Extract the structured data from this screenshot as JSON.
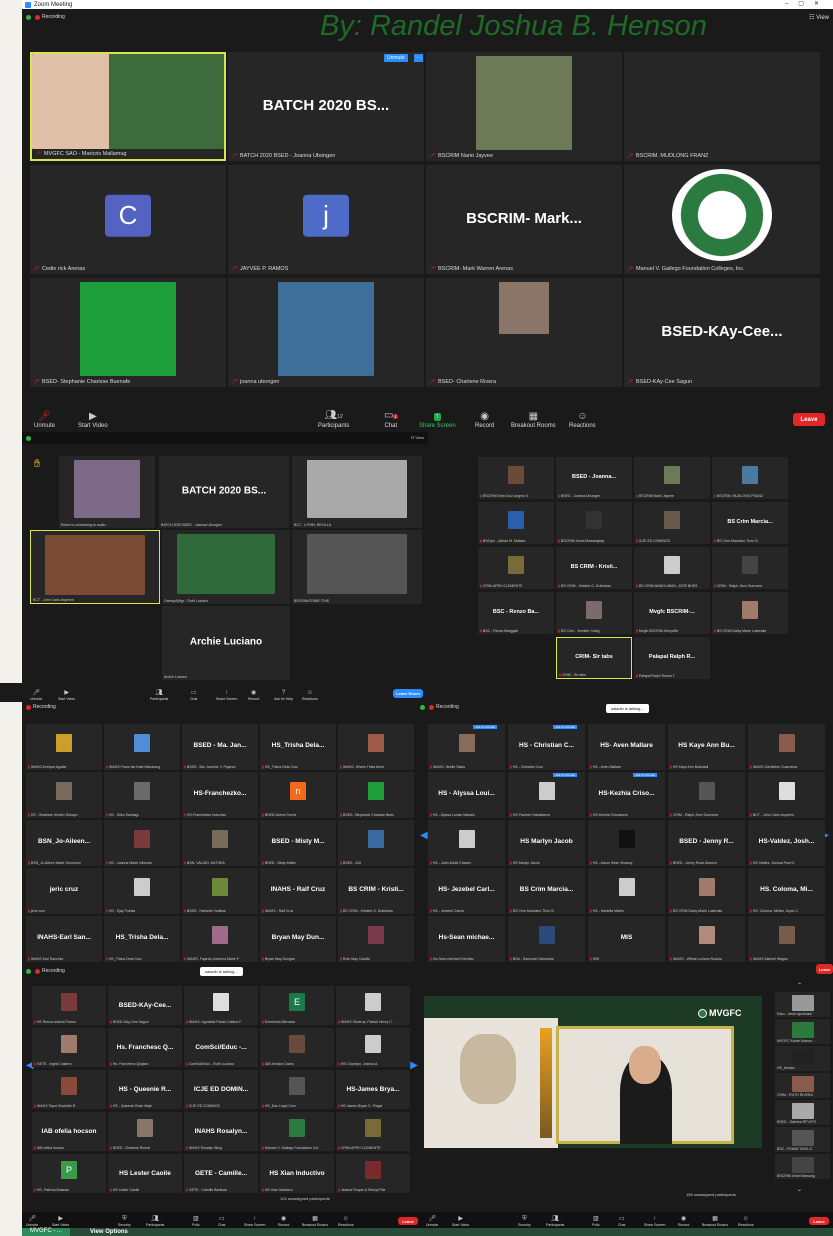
{
  "app_title": "Zoom Meeting",
  "recording": "Recording",
  "gallery_view": "View",
  "watermark": "By: Randel Joshua B. Henson",
  "unmute_small": "Unmute",
  "main_tiles": [
    {
      "name": "MVGFC SAO - Maricris Mallamug",
      "big": "",
      "photo": "#3d6b3b"
    },
    {
      "name": "BATCH 2020 BSED - Joanna Ubongen",
      "big": "BATCH 2020 BS..."
    },
    {
      "name": "BSCRIM Nario Jayvee",
      "big": "",
      "photo": "#6d7a58"
    },
    {
      "name": "BSCRIM. MUDLONG FRANZ",
      "big": ""
    },
    {
      "name": "Cedie rick Arenas",
      "big": "",
      "avatar": "C",
      "avatar_color": "#5462c2"
    },
    {
      "name": "JAYVEE P. RAMOS",
      "big": "",
      "avatar": "j",
      "avatar_color": "#4e6bc7"
    },
    {
      "name": "BSCRIM- Mark Warren Arenas",
      "big": "BSCRIM-  Mark..."
    },
    {
      "name": "Manuel V. Gallego Foundation Colleges, Inc.",
      "big": "",
      "photo": "#2b7a3f"
    },
    {
      "name": "BSED- Stephanie Charisse Buenafe",
      "big": "",
      "photo": "#1f9e3c"
    },
    {
      "name": "joanna ubongen",
      "big": "",
      "photo": "#3d6f99"
    },
    {
      "name": "BSED- Charlene Rivera",
      "big": "",
      "photo": "#8a7569"
    },
    {
      "name": "BSED-KAy-Cee Sagun",
      "big": "BSED-KAy-Cee..."
    }
  ],
  "toolbar": {
    "unmute": "Unmute",
    "start_video": "Start Video",
    "participants": "Participants",
    "participants_count": "12",
    "chat": "Chat",
    "chat_badge": "1",
    "share_screen": "Share Screen",
    "record": "Record",
    "breakout": "Breakout Rooms",
    "reactions": "Reactions",
    "leave": "Leave"
  },
  "win2": {
    "tiles": [
      {
        "name": "Eldice is connecting to audio...",
        "big": "",
        "photo": "#7c6a86"
      },
      {
        "name": "BATCH 2020 BSED - Joanna Ubongen",
        "big": "BATCH 2020 BS..."
      },
      {
        "name": "BCT - LYRIEL REVILLA",
        "big": "",
        "photo": "#a9a9a9"
      },
      {
        "name": "BCT - John Carlo Asperen",
        "big": "",
        "photo": "#7a4a34"
      },
      {
        "name": "Cams(uf)Mgr - Ruth Luciano",
        "big": "",
        "photo": "#2f6b3a"
      },
      {
        "name": "BSCRIM/CRIME-THIS",
        "big": "",
        "photo": "#555"
      },
      {
        "name": "Archie Luciano",
        "big": "Archie Luciano"
      }
    ],
    "toolbar": {
      "participants": "Participants",
      "participants_count": "7",
      "chat": "Chat",
      "share": "Share Screen",
      "record": "Record",
      "help": "Ask for Help",
      "reactions": "Reactions",
      "leave": "Leave Room"
    }
  },
  "win3": {
    "tiles": [
      {
        "label": "",
        "name": "BSCRIM Dela Cruz Angelo K.",
        "p": "#6b4a3a"
      },
      {
        "label": "BSED - Joanna...",
        "name": "BSED - Joanna Ubongen"
      },
      {
        "label": "",
        "name": "BSCRIM Nario Jayvee",
        "p": "#6d7a58"
      },
      {
        "label": "",
        "name": "BSCRIM. MUDLONG FRANZ",
        "p": "#4a7aa0"
      },
      {
        "label": "",
        "name": "BSCrpn - Adrian M. Mallare",
        "p": "#2a5fb0"
      },
      {
        "label": "",
        "name": "BSCRIM Jewel Mawangbay",
        "p": "#333"
      },
      {
        "label": "",
        "name": "ICJE ED DOMINGO",
        "p": "#6a5a4a"
      },
      {
        "label": "BS Crim Marcia...",
        "name": "BS Crim Marciano Tinio III"
      },
      {
        "label": "",
        "name": "CRIM-APEH CLEMENTE",
        "p": "#7a6a3a"
      },
      {
        "label": "BS CRIM - Kristi...",
        "name": "BS CRIM - Kristine G. Dublubas"
      },
      {
        "label": "",
        "name": "BS CRIM MANGLIWAN, JOSE BHES",
        "p": "#ccc"
      },
      {
        "label": "",
        "name": "CRIM - Ralph Jhon Guevarra",
        "p": "#444"
      },
      {
        "label": "BSC - Renzo Ba...",
        "name": "BSC - Renzo Banggali"
      },
      {
        "label": "",
        "name": "BS Crim - Jennifer Cabig",
        "p": "#7a6c6a"
      },
      {
        "label": "Mvgfc  BSCRIM-...",
        "name": "Mvgfc BSCRIM-Kenyaffic"
      },
      {
        "label": "",
        "name": "BS CRIM Daisy Marie Lusenata",
        "p": "#a07a6a"
      },
      {
        "label": "CRIM- Sir tabs",
        "name": "CRIM - Sir tabs"
      },
      {
        "label": "Palapal  Ralph R...",
        "name": "Palapal Ralph Raven T"
      }
    ]
  },
  "win4": {
    "talking": "saladin is talking...",
    "tiles": [
      {
        "label": "",
        "name": "INAHS-Enrique Aguilar",
        "p": "#c9a02a"
      },
      {
        "label": "",
        "name": "INAHS Franz Ian Kate Manarang",
        "p": "#4f8ed6"
      },
      {
        "label": "BSED - Ma. Jan...",
        "name": "BSED - Ma. Jannine V. Pajaron"
      },
      {
        "label": "HS_Trisha  Dela...",
        "name": "HS_Trisha Dela Cruz"
      },
      {
        "label": "",
        "name": "INAHS- Hilarrs Trisia Anne",
        "p": "#a05a4a"
      },
      {
        "label": "",
        "name": "HS - Sharlane Kirsten Dimayu",
        "p": "#7a6a5a"
      },
      {
        "label": "",
        "name": "HS - Stiko Santiago",
        "p": "#6a6a6a"
      },
      {
        "label": "HS-Franchezko...",
        "name": "HS-Franchezko Inductivo"
      },
      {
        "label": "",
        "name": "BSED-Noemi Torres",
        "avatar": "n",
        "ac": "#f26a1a"
      },
      {
        "label": "",
        "name": "BSED- Stephanie Charisse Buen",
        "p": "#1f9e3c"
      },
      {
        "label": "BSN_Jo-Aileen...",
        "name": "BSN_Jo-Aileen Marie Geronimo"
      },
      {
        "label": "",
        "name": "HS - Joanna Marie Ulbunan",
        "p": "#7a3a3a"
      },
      {
        "label": "",
        "name": "BSN- VALINO, ANTHEA",
        "p": "#7a6a5a"
      },
      {
        "label": "BSED - Misty M...",
        "name": "BSED - Misty Mateo"
      },
      {
        "label": "",
        "name": "BSED - IDA",
        "p": "#3a6aa0"
      },
      {
        "label": "jeric cruz",
        "name": "jeric cruz"
      },
      {
        "label": "",
        "name": "HS - Ejay Fuelda",
        "p": "#ccc"
      },
      {
        "label": "",
        "name": "BSED - Harlaine Vodillas",
        "p": "#6a8a3a"
      },
      {
        "label": "INAHS - Ralf Cruz",
        "name": "INAHS - Ralf Cruz"
      },
      {
        "label": "BS CRIM - Kristi...",
        "name": "BS CRIM - Kristine G. Dublubas"
      },
      {
        "label": "INAHS-Earl San...",
        "name": "INAHS Earl Sanchez"
      },
      {
        "label": "HS_Trisha  Dela...",
        "name": "HS_Trisha Dela Cruz"
      },
      {
        "label": "",
        "name": "INAHS- Fajardo,Joahnna Marie F.",
        "p": "#a06a8a"
      },
      {
        "label": "Bryan May Dun...",
        "name": "Bryan May Dungao"
      },
      {
        "label": "",
        "name": "Ruth May Castillo",
        "p": "#7a3a4a"
      }
    ]
  },
  "win5": {
    "talking": "saladin is talking...",
    "tiles": [
      {
        "label": "",
        "name": "INAHS- Ibrelle Salas",
        "p": "#8a6a5a",
        "btn": "Ask to Unmute"
      },
      {
        "label": "HS - Christian C...",
        "name": "HS - Christian Cruz",
        "btn": "Ask to Unmute"
      },
      {
        "label": "HS- Aven Mallare",
        "name": "HS - Aven Mallare"
      },
      {
        "label": "HS Kaye Ann Bu...",
        "name": "HS Kaye Ann Bulanadi"
      },
      {
        "label": "",
        "name": "INAHS-Geraldine Cuaresma",
        "p": "#8a5a4a"
      },
      {
        "label": "HS - Alyssa Loui...",
        "name": "HS - Alyssa Louise Manalo"
      },
      {
        "label": "",
        "name": "HS Paulven Sabadeens",
        "p": "#ccc",
        "btn": "Ask to Unmute"
      },
      {
        "label": "HS-Kezhia Criso...",
        "name": "HS-Kezhia Crisostomo",
        "btn": "Ask to Unmute"
      },
      {
        "label": "",
        "name": "CRIM - Ralph Jhon Guevarra",
        "p": "#555"
      },
      {
        "label": "",
        "name": "BCT - John Carlo Asperen",
        "p": "#ddd"
      },
      {
        "label": "",
        "name": "HS - John Adriel Chavez",
        "p": "#ccc"
      },
      {
        "label": "HS Marlyn Jacob",
        "name": "HS Marlyn Jacob"
      },
      {
        "label": "",
        "name": "HS - Aaron Sean Vinasoy",
        "p": "#111"
      },
      {
        "label": "BSED - Jenny R...",
        "name": "BSED - Jenny Rose Alamon"
      },
      {
        "label": "HS-Valdez,  Josh...",
        "name": "HS-Valdez, Joshua Paul G."
      },
      {
        "label": "HS- Jezebel Carl...",
        "name": "HS - Jezebel Carlos"
      },
      {
        "label": "BS Crim Marcia...",
        "name": "BS Crim Marciano Tinio III"
      },
      {
        "label": "",
        "name": "HS - Mariella Mateo",
        "p": "#ccc"
      },
      {
        "label": "",
        "name": "BS CRIM Daisy Marie Lusenata",
        "p": "#a07a6a"
      },
      {
        "label": "HS. Coloma, Mi...",
        "name": "HS. Coloma, Miriam Joyce C."
      },
      {
        "label": "Hs-Sean  michae...",
        "name": "Hs-Sean michael Enerlato"
      },
      {
        "label": "",
        "name": "BSA - Sammuel Samanda",
        "p": "#2a4a7a"
      },
      {
        "label": "MIS",
        "name": "MIS"
      },
      {
        "label": "",
        "name": "INAHS - Wilma Luciano Rodula",
        "p": "#b08a7a"
      },
      {
        "label": "",
        "name": "INAHS Maricel Wagan",
        "p": "#7a5a4a"
      }
    ]
  },
  "win6": {
    "talking": "saladin is talking...",
    "tiles": [
      {
        "label": "",
        "name": "HS Renza Austria Franco",
        "p": "#7a3a3a"
      },
      {
        "label": "BSED-KAy-Cee...",
        "name": "BSED-KAy-Cee Sagun"
      },
      {
        "label": "",
        "name": "INAHS- Agnabak Paula Cristina F.",
        "p": "#ddd"
      },
      {
        "label": "",
        "name": "Emerlinda Mercado",
        "avatar": "E",
        "ac": "#1a7a4a"
      },
      {
        "label": "",
        "name": "INAHS Oliveros, Patrick Henry C.",
        "p": "#ccc"
      },
      {
        "label": "",
        "name": "GETE - Ingrid Calareo",
        "p": "#a07a6a"
      },
      {
        "label": "Hs. Franchesc Q...",
        "name": "Hs. Franchesc Quijano"
      },
      {
        "label": "ComSci/Educ -...",
        "name": "ComSci/Educ - Ruth Luciano"
      },
      {
        "label": "",
        "name": "IAB Jessica Cacho",
        "p": "#6a4a3a"
      },
      {
        "label": "",
        "name": "IHS Ocampo, Joshua A.",
        "p": "#ccc"
      },
      {
        "label": "",
        "name": "INAHS Tique Rochelle R.",
        "p": "#8a4a3a"
      },
      {
        "label": "HS - Queenie R...",
        "name": "HS - Queenie Rose Maje"
      },
      {
        "label": "ICJE ED DOMIN...",
        "name": "ICJE ED DOMINGO"
      },
      {
        "label": "",
        "name": "HS_Dan Lloyd Cruz",
        "p": "#555"
      },
      {
        "label": "HS-James  Brya...",
        "name": "HS James Bryan C. Pingol"
      },
      {
        "label": "IAB ofelia hocson",
        "name": "IAB ofelia hocson"
      },
      {
        "label": "",
        "name": "BSED- Charlene Rivera",
        "p": "#8a7569"
      },
      {
        "label": "INAHS Rosalyn...",
        "name": "INAHS Rosalyn Bilog"
      },
      {
        "label": "",
        "name": "Manuel V. Gallego Foundation Col.",
        "p": "#2b7a3f"
      },
      {
        "label": "",
        "name": "CRIM-APEH CLEMENTE",
        "p": "#7a6a3a"
      },
      {
        "label": "",
        "name": "HS- Patricia Bulacan",
        "avatar": "P",
        "ac": "#3a9a4a"
      },
      {
        "label": "HS Lester Caoile",
        "name": "HS Lester Caoile"
      },
      {
        "label": "GETE - Camille...",
        "name": "GETE - Camille Bautista"
      },
      {
        "label": "HS Xian Inductivo",
        "name": "HS Xian Inductivo"
      },
      {
        "label": "",
        "name": "Jeanne Roque & Sheryll Pila",
        "p": "#7a2a2a"
      }
    ],
    "unassigned": "125 unassigned participants"
  },
  "win7": {
    "brand": "MVGFC",
    "unassigned": "156 unassigned participants",
    "side": [
      {
        "name": "Educ - Irene Apolinario",
        "p": "#999"
      },
      {
        "name": "MVGFC Admin Manue...",
        "p": "#2a7a3a"
      },
      {
        "name": "HS_Kesian",
        "p": "#222"
      },
      {
        "name": "CRIM - RUTH RIVERA",
        "p": "#8a5a4a"
      },
      {
        "name": "BSED - Sabrina RFVSTS",
        "p": "#aaa"
      },
      {
        "name": "BSC - ROMM TARA-O",
        "p": "#555"
      },
      {
        "name": "BSCRIM Jewel Mawang",
        "p": "#444"
      }
    ]
  },
  "mini_toolbar": {
    "unmute": "Unmute",
    "start_video": "Start Video",
    "security": "Security",
    "participants": "Participants",
    "participants_count": "127",
    "polls": "Polls",
    "chat": "Chat",
    "share": "Share Screen",
    "record": "Record",
    "breakout": "Breakout Rooms",
    "reactions": "Reactions",
    "leave": "Leave"
  },
  "taskbar": {
    "item1": "MVGFC - ...",
    "item2": "View Options"
  }
}
